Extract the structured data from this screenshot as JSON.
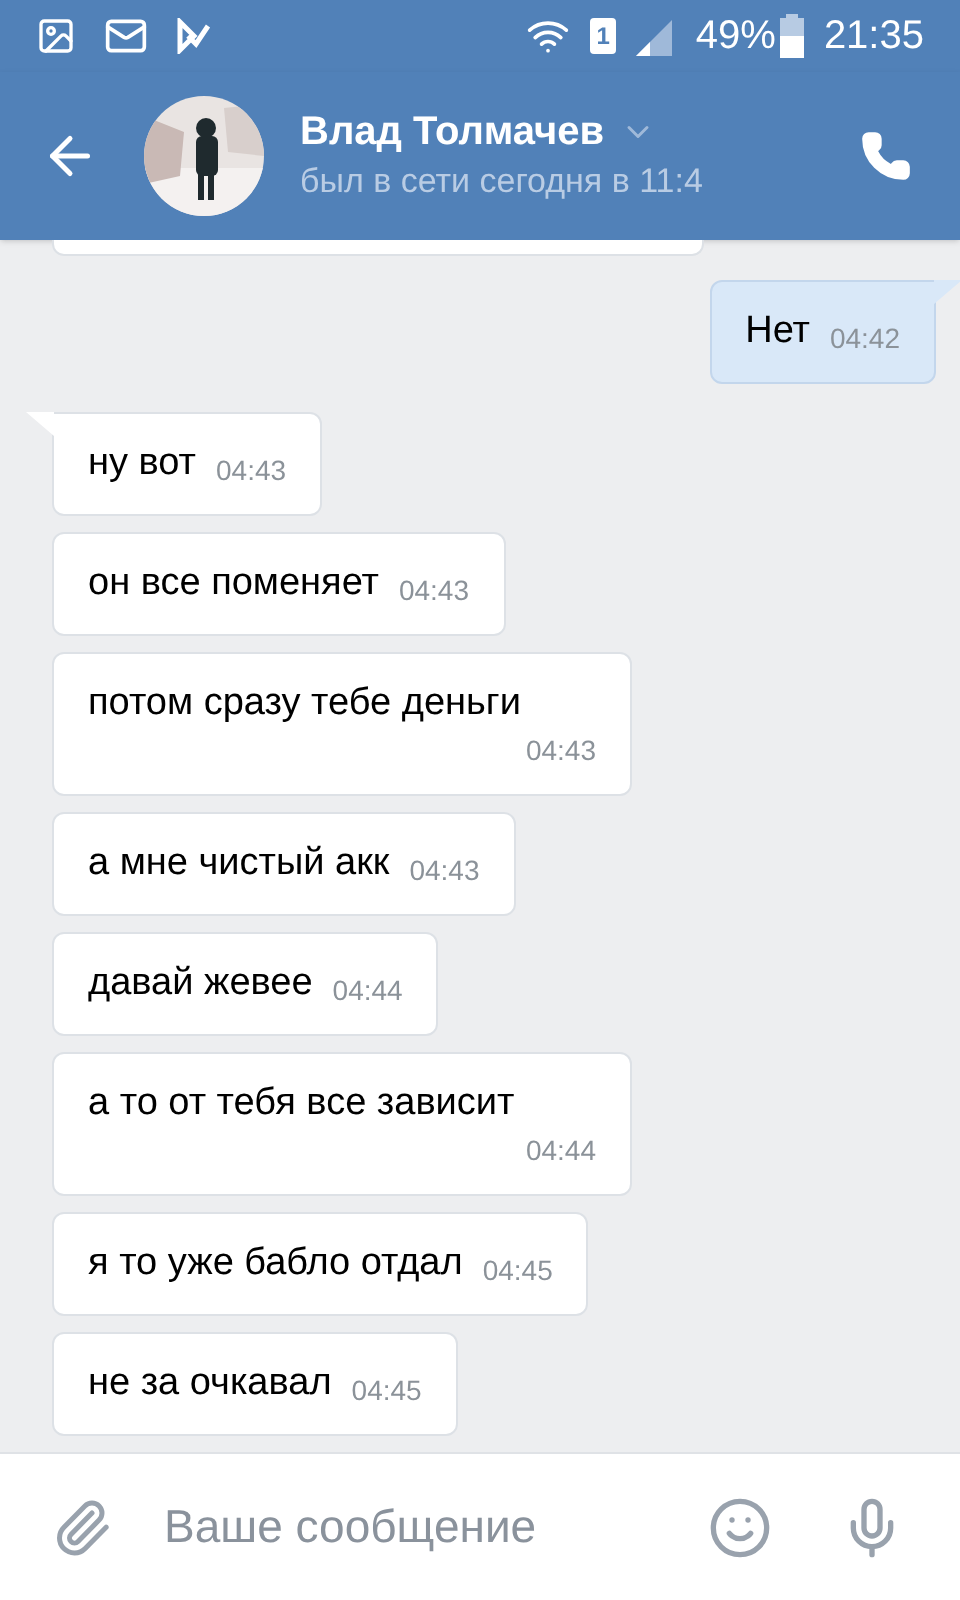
{
  "status_bar": {
    "sim": "1",
    "battery": "49%",
    "time": "21:35"
  },
  "header": {
    "name": "Влад Толмачев",
    "status": "был в сети сегодня в 11:4"
  },
  "messages": [
    {
      "outgoing": true,
      "text": "Нет",
      "time": "04:42",
      "tail": true
    },
    {
      "outgoing": false,
      "text": "ну вот",
      "time": "04:43",
      "tail": true
    },
    {
      "outgoing": false,
      "text": "он все поменяет",
      "time": "04:43",
      "tail": false
    },
    {
      "outgoing": false,
      "text": "потом сразу тебе деньги",
      "time": "04:43",
      "tail": false
    },
    {
      "outgoing": false,
      "text": "а мне чистый акк",
      "time": "04:43",
      "tail": false
    },
    {
      "outgoing": false,
      "text": "давай жевее",
      "time": "04:44",
      "tail": false
    },
    {
      "outgoing": false,
      "text": "а то от тебя все зависит",
      "time": "04:44",
      "tail": false
    },
    {
      "outgoing": false,
      "text": "я то уже бабло отдал",
      "time": "04:45",
      "tail": false
    },
    {
      "outgoing": false,
      "text": "не за очкавал",
      "time": "04:45",
      "tail": false
    }
  ],
  "composer": {
    "placeholder": "Ваше сообщение"
  }
}
